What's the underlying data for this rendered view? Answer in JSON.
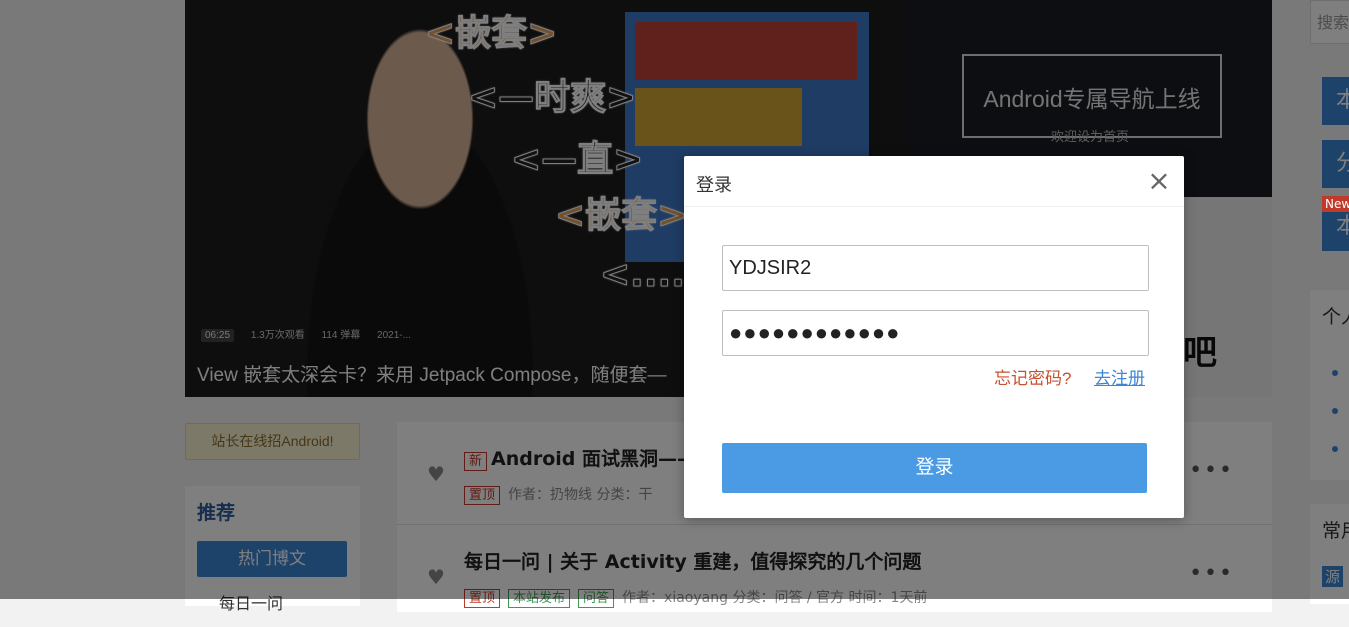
{
  "banner": {
    "slogans": [
      "<嵌套>",
      "<—时爽>",
      "<—直>",
      "<嵌套>",
      "<....."
    ],
    "duration": "06:25",
    "views": "1.3万次观看",
    "danmaku": "114 弹幕",
    "date": "2021-...",
    "title": "View 嵌套太深会卡？来用 Jetpack Compose，随便套—"
  },
  "side_banner": {
    "headline": "Android专属导航上线",
    "subline": "欢迎设为首页",
    "partial_text": "吧"
  },
  "recruit": {
    "label": "站长在线招Android!"
  },
  "recommend": {
    "heading": "推荐",
    "active_item": "热门博文",
    "next_item": "每日一问"
  },
  "posts": [
    {
      "new_tag": "新",
      "title": "Android 面试黑洞——",
      "pin_tag": "置顶",
      "meta": "作者：扔物线   分类：干"
    },
    {
      "title": "每日一问 | 关于 Activity 重建，值得探究的几个问题",
      "pin_tag": "置顶",
      "tag2": "本站发布",
      "tag3": "问答",
      "meta": "作者：xiaoyang   分类：问答 / 官方   时间：1天前"
    }
  ],
  "right_col": {
    "search_placeholder": "搜索",
    "btn1": "本",
    "btn2": "分",
    "btn3": "本",
    "new_badge": "New",
    "panel1_heading": "个人",
    "panel2_heading": "常用",
    "panel2_item": "源"
  },
  "login_modal": {
    "title": "登录",
    "close_glyph": "×",
    "username_value": "YDJSIR2",
    "password_value": "●●●●●●●●●●●●",
    "forgot_label": "忘记密码?",
    "register_label": "去注册",
    "submit_label": "登录"
  },
  "colors": {
    "accent": "#4a9be3",
    "link_red": "#c8502f",
    "link_blue": "#3b86d6"
  }
}
